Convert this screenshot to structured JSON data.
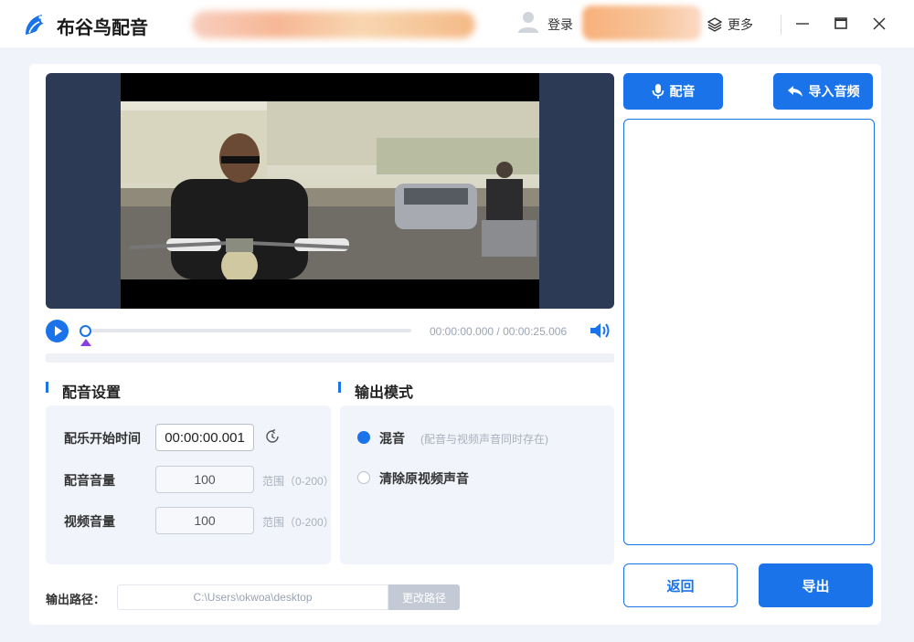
{
  "window": {
    "app_title": "布谷鸟配音",
    "login_label": "登录",
    "more_label": "更多"
  },
  "player": {
    "time_text": "00:00:00.000 / 00:00:25.006",
    "progress": 0
  },
  "dub_settings": {
    "title": "配音设置",
    "start_time_label": "配乐开始时间",
    "start_time_value": "00:00:00.001",
    "dub_volume_label": "配音音量",
    "dub_volume_value": "100",
    "dub_volume_hint": "范围（0-200）",
    "video_volume_label": "视频音量",
    "video_volume_value": "100",
    "video_volume_hint": "范围（0-200）"
  },
  "output_mode": {
    "title": "输出模式",
    "options": [
      {
        "label": "混音",
        "note": "(配音与视频声音同时存在)",
        "selected": true
      },
      {
        "label": "清除原视频声音",
        "note": "",
        "selected": false
      }
    ]
  },
  "output_path": {
    "label": "输出路径：",
    "value": "C:\\Users\\okwoa\\desktop",
    "change_button": "更改路径"
  },
  "actions": {
    "dub_button": "配音",
    "import_audio_button": "导入音频",
    "back_button": "返回",
    "export_button": "导出"
  },
  "colors": {
    "accent": "#1a73e8",
    "marker": "#8a3ee0"
  }
}
